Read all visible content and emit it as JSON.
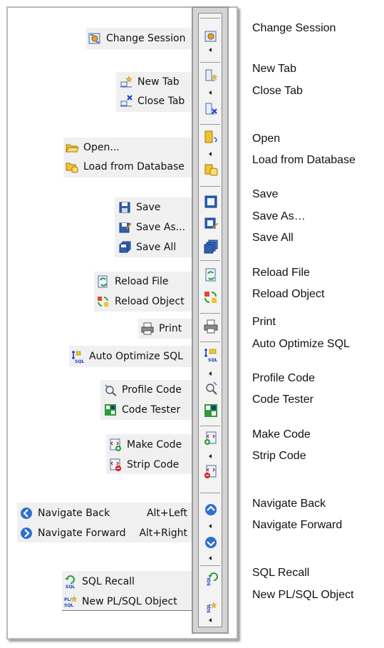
{
  "menu": {
    "change_session": "Change Session",
    "new_tab": "New Tab",
    "close_tab": "Close Tab",
    "open": "Open...",
    "load_from_database": "Load from Database",
    "save": "Save",
    "save_as": "Save As...",
    "save_all": "Save All",
    "reload_file": "Reload File",
    "reload_object": "Reload Object",
    "print": "Print",
    "auto_optimize_sql": "Auto Optimize SQL",
    "profile_code": "Profile Code",
    "code_tester": "Code Tester",
    "make_code": "Make Code",
    "strip_code": "Strip Code",
    "navigate_back": "Navigate Back",
    "navigate_back_shortcut": "Alt+Left",
    "navigate_forward": "Navigate Forward",
    "navigate_forward_shortcut": "Alt+Right",
    "sql_recall": "SQL Recall",
    "new_plsql_object": "New PL/SQL Object"
  },
  "callouts": {
    "change_session": "Change Session",
    "new_tab": "New Tab",
    "close_tab": "Close Tab",
    "open": "Open",
    "load_from_database": "Load from Database",
    "save": "Save",
    "save_as": "Save As…",
    "save_all": "Save All",
    "reload_file": "Reload File",
    "reload_object": "Reload Object",
    "print": "Print",
    "auto_optimize_sql": "Auto Optimize SQL",
    "profile_code": "Profile Code",
    "code_tester": "Code Tester",
    "make_code": "Make Code",
    "strip_code": "Strip Code",
    "navigate_back": "Navigate Back",
    "navigate_forward": "Navigate Forward",
    "sql_recall": "SQL Recall",
    "new_plsql_object": "New PL/SQL Object"
  },
  "icons": {
    "change_session": "change-session-icon",
    "new_tab": "new-tab-icon",
    "close_tab": "close-tab-icon",
    "open": "open-folder-icon",
    "load_from_database": "load-from-database-icon",
    "save": "save-icon",
    "save_as": "save-as-icon",
    "save_all": "save-all-icon",
    "reload_file": "reload-file-icon",
    "reload_object": "reload-object-icon",
    "print": "print-icon",
    "auto_optimize_sql": "auto-optimize-sql-icon",
    "profile_code": "profile-code-icon",
    "code_tester": "code-tester-icon",
    "make_code": "make-code-icon",
    "strip_code": "strip-code-icon",
    "navigate_back": "navigate-back-icon",
    "navigate_forward": "navigate-forward-icon",
    "sql_recall": "sql-recall-icon",
    "new_plsql_object": "new-plsql-object-icon"
  },
  "colors": {
    "nav_blue": "#2f6fd0",
    "folder_yellow": "#f2c230",
    "close_x": "#1a3ccc",
    "toolbar_bg": "#d4d4d4",
    "menu_bg": "#f0f0f0"
  }
}
